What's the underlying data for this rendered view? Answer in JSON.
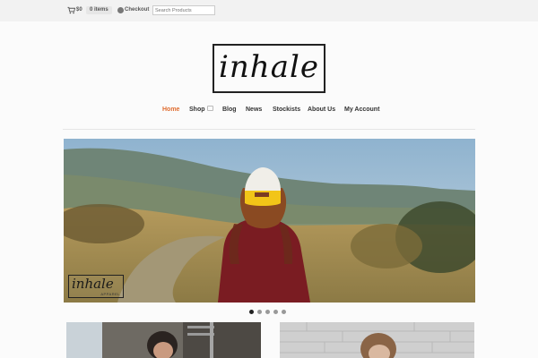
{
  "topbar": {
    "cart_icon": "cart-icon",
    "cart_total": "$0",
    "cart_items": "0 items",
    "checkout_icon": "checkout-icon",
    "checkout_label": "Checkout",
    "search_placeholder": "Search Products"
  },
  "logo": {
    "text": "inhale"
  },
  "nav": {
    "items": [
      {
        "label": "Home",
        "active": true
      },
      {
        "label": "Shop",
        "has_dropdown": true
      },
      {
        "label": "Blog"
      },
      {
        "label": "News"
      },
      {
        "label": "Stockists"
      },
      {
        "label": "About Us"
      },
      {
        "label": "My Account"
      }
    ],
    "active_color": "#e06c2f"
  },
  "slider": {
    "slide_count": 5,
    "active_index": 0,
    "watermark": {
      "title": "inhale",
      "subtitle": "APPAREL"
    }
  }
}
